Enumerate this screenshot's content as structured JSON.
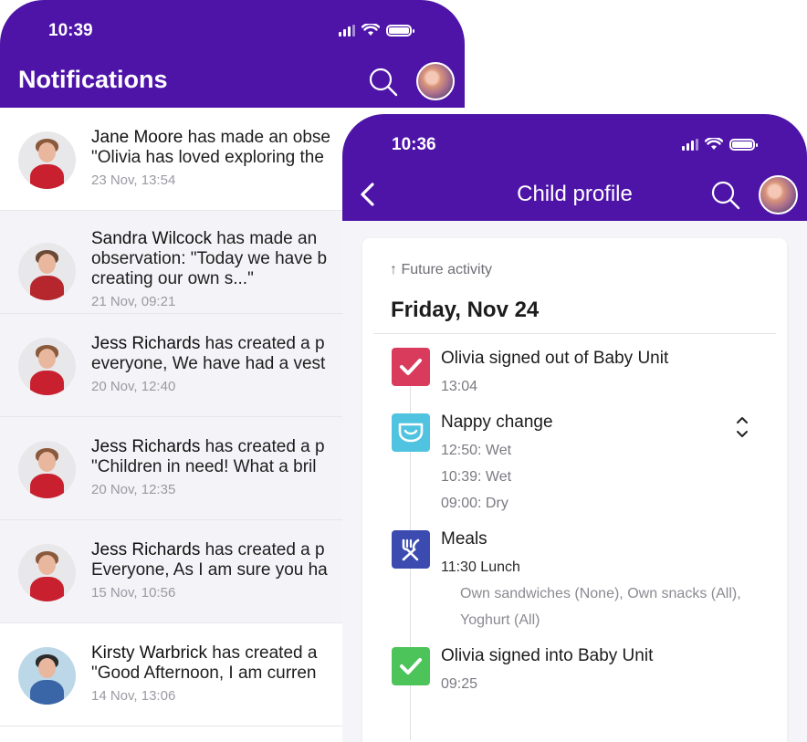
{
  "notifications_screen": {
    "status_time": "10:39",
    "title": "Notifications",
    "items": [
      {
        "name": "Jane Moore",
        "text": " has made an obse",
        "line2": "\"Olivia has loved exploring the",
        "meta": "23 Nov, 13:54",
        "avatar_color": "#c8202f"
      },
      {
        "name": "Sandra Wilcock",
        "text": "  has made an",
        "line2": "observation: \"Today we have b",
        "line3": "creating our own s...\"",
        "meta": "21 Nov, 09:21",
        "avatar_color": "#b5272d"
      },
      {
        "name": "Jess Richards",
        "text": " has created a p",
        "line2": "everyone, We have had a vest",
        "meta": "20 Nov, 12:40",
        "avatar_color": "#c8202f"
      },
      {
        "name": "Jess Richards",
        "text": " has created a p",
        "line2": "\"Children in need! What a bril",
        "meta": "20 Nov, 12:35",
        "avatar_color": "#c8202f"
      },
      {
        "name": "Jess Richards",
        "text": " has created a p",
        "line2": "Everyone, As I am sure you ha",
        "meta": "15 Nov, 10:56",
        "avatar_color": "#c8202f"
      },
      {
        "name": "Kirsty Warbrick",
        "text": " has created a",
        "line2": "\"Good Afternoon, I am curren",
        "meta": "14 Nov, 13:06",
        "avatar_color": "#3a66a8"
      }
    ]
  },
  "child_profile_screen": {
    "status_time": "10:36",
    "title": "Child profile",
    "future_activity": "Future activity",
    "day": "Friday, Nov 24",
    "activities": [
      {
        "title": "Olivia signed out of Baby Unit",
        "times": [
          "13:04"
        ],
        "icon": "checkbox-icon",
        "color": "#d93b5c"
      },
      {
        "title": "Nappy change",
        "times": [
          "12:50: Wet",
          "10:39: Wet",
          "09:00: Dry"
        ],
        "icon": "nappy-icon",
        "color": "#4fc3e0"
      },
      {
        "title": "Meals",
        "times": [
          "11:30 Lunch"
        ],
        "details": "Own sandwiches (None), Own snacks (All), Yoghurt (All)",
        "icon": "cutlery-icon",
        "color": "#3b4bb0"
      },
      {
        "title": "Olivia signed into Baby Unit",
        "times": [
          "09:25"
        ],
        "icon": "checkbox-icon",
        "color": "#4cc45a"
      }
    ]
  },
  "colors": {
    "header_purple": "#4e14a8"
  }
}
